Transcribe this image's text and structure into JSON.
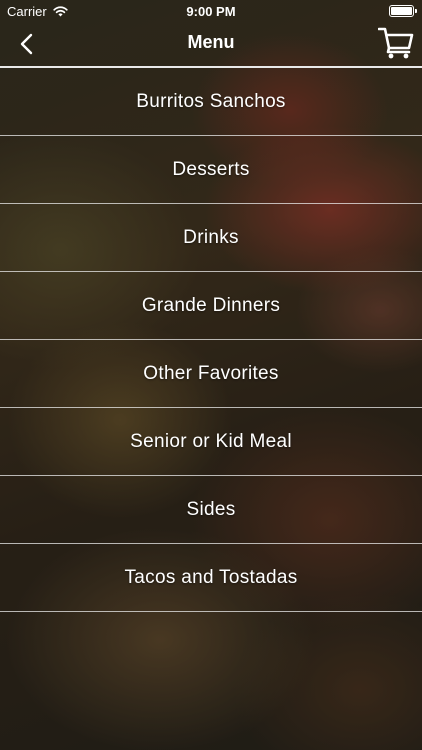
{
  "status_bar": {
    "carrier": "Carrier",
    "time": "9:00 PM",
    "battery_level": 1.0,
    "icons": [
      "wifi-icon",
      "battery-icon"
    ]
  },
  "nav": {
    "title": "Menu",
    "back_icon": "chevron-left-icon",
    "cart_icon": "shopping-cart-icon"
  },
  "menu": {
    "items": [
      {
        "label": "Burritos Sanchos"
      },
      {
        "label": "Desserts"
      },
      {
        "label": "Drinks"
      },
      {
        "label": "Grande Dinners"
      },
      {
        "label": "Other Favorites"
      },
      {
        "label": "Senior or Kid Meal"
      },
      {
        "label": "Sides"
      },
      {
        "label": "Tacos and Tostadas"
      }
    ]
  },
  "colors": {
    "text": "#ffffff",
    "divider": "#e9e9e9"
  }
}
